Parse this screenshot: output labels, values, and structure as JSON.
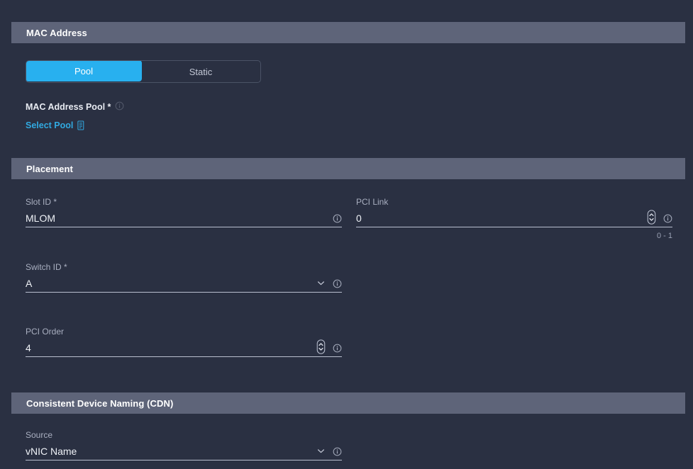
{
  "sections": {
    "mac_address": {
      "title": "MAC Address",
      "toggle": {
        "pool_label": "Pool",
        "static_label": "Static",
        "selected": "Pool"
      },
      "pool_field": {
        "label": "MAC Address Pool *",
        "link_label": "Select Pool",
        "link_icon": "document-list-icon",
        "info_icon": "info-icon"
      }
    },
    "placement": {
      "title": "Placement",
      "fields": [
        {
          "label": "Slot ID *",
          "value": "MLOM",
          "type": "text",
          "info_icon": "info-icon"
        },
        {
          "label": "PCI Link",
          "value": "0",
          "type": "number",
          "hint": "0 - 1",
          "spinner_icon": "stepper-icon",
          "info_icon": "info-icon"
        },
        {
          "label": "Switch ID *",
          "value": "A",
          "type": "select",
          "chevron_icon": "chevron-down-icon",
          "info_icon": "info-icon"
        },
        {
          "label": "PCI Order",
          "value": "4",
          "type": "number",
          "spinner_icon": "stepper-icon",
          "info_icon": "info-icon"
        }
      ]
    },
    "cdn": {
      "title": "Consistent Device Naming (CDN)",
      "fields": [
        {
          "label": "Source",
          "value": "vNIC Name",
          "type": "select",
          "chevron_icon": "chevron-down-icon",
          "info_icon": "info-icon"
        }
      ]
    }
  },
  "colors": {
    "background": "#2a3042",
    "band": "#5e6479",
    "accent": "#28b0ef",
    "link": "#31a9e0",
    "underline": "#b9bfcf",
    "label_muted": "#a9afc0"
  }
}
